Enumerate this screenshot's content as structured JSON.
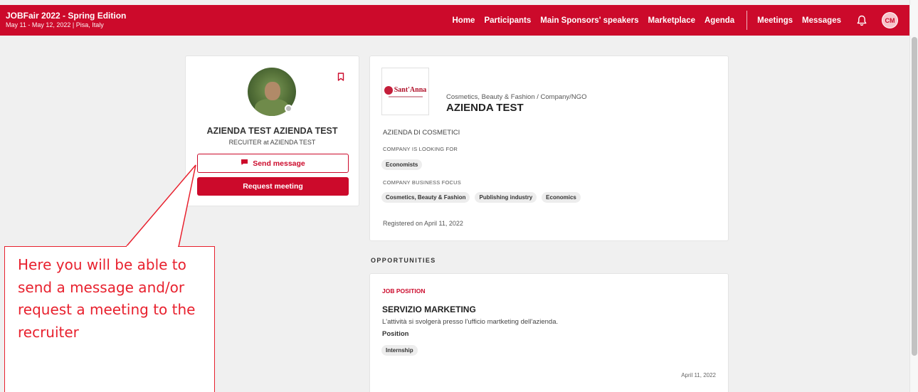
{
  "header": {
    "event_title": "JOBFair 2022 - Spring Edition",
    "event_subtitle": "May 11 - May 12, 2022 | Pisa, Italy",
    "nav": [
      "Home",
      "Participants",
      "Main Sponsors' speakers",
      "Marketplace",
      "Agenda"
    ],
    "nav_right": [
      "Meetings",
      "Messages"
    ],
    "user_initials": "CM"
  },
  "profile": {
    "name": "AZIENDA TEST AZIENDA TEST",
    "role": "RECUITER at AZIENDA TEST",
    "send_message_label": "Send message",
    "request_meeting_label": "Request meeting"
  },
  "company": {
    "logo_text": "Sant'Anna",
    "category": "Cosmetics, Beauty & Fashion / Company/NGO",
    "name": "AZIENDA TEST",
    "description": "AZIENDA DI COSMETICI",
    "looking_for_label": "COMPANY IS LOOKING FOR",
    "looking_for": [
      "Economists"
    ],
    "focus_label": "COMPANY BUSINESS FOCUS",
    "focus": [
      "Cosmetics, Beauty & Fashion",
      "Publishing industry",
      "Economics"
    ],
    "registered": "Registered on April 11, 2022"
  },
  "opportunities": {
    "heading": "OPPORTUNITIES",
    "items": [
      {
        "type": "JOB POSITION",
        "title": "SERVIZIO MARKETING",
        "description": "L'attività si svolgerà presso l'ufficio martketing dell'azienda.",
        "position_label": "Position",
        "position": "Internship",
        "date": "April 11, 2022"
      }
    ]
  },
  "annotation": {
    "text": "Here you will be able to send a message and/or request a meeting to the recruiter"
  },
  "colors": {
    "brand": "#cc0a2b",
    "annotation": "#e8212e",
    "background": "#f0f0f0"
  },
  "icons": [
    "bell-icon",
    "bookmark-icon",
    "message-icon"
  ]
}
